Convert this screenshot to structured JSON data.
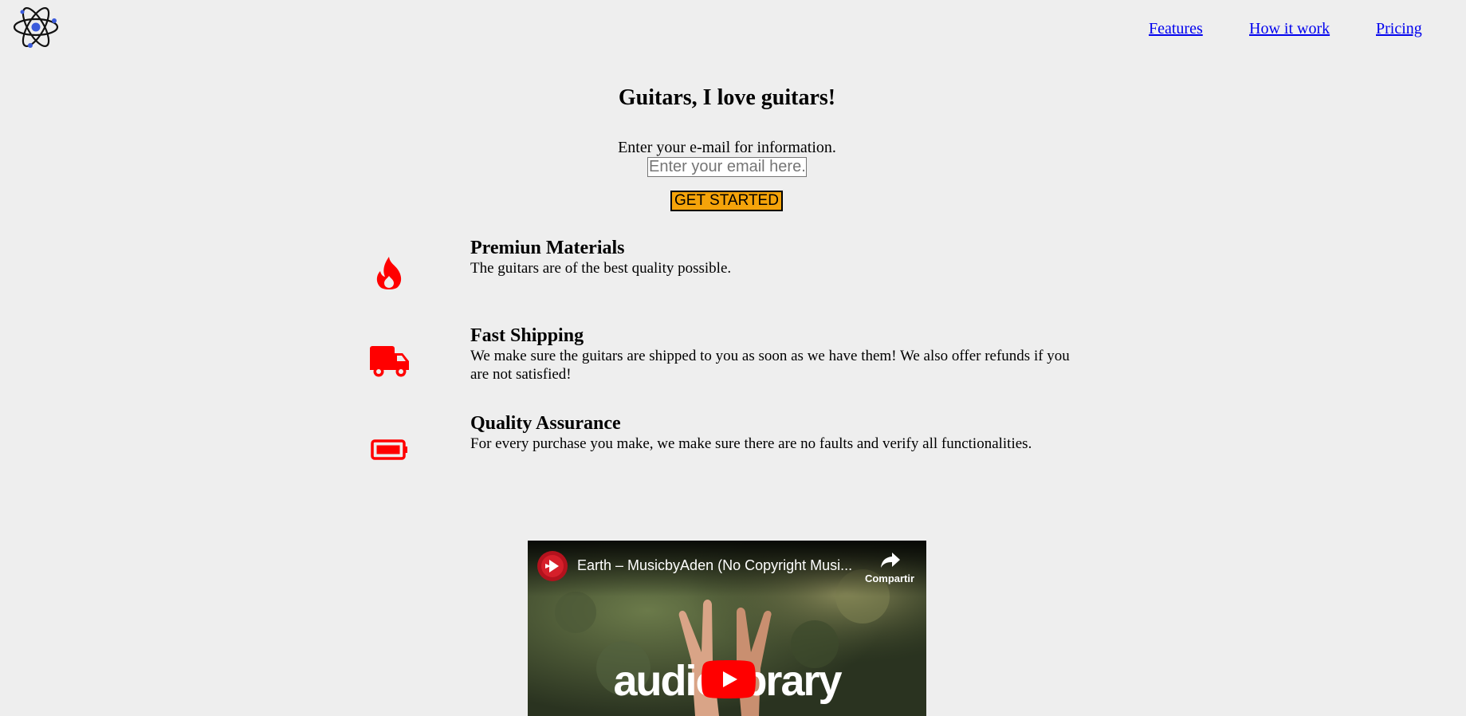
{
  "header": {
    "logo_icon": "atom-icon",
    "nav": [
      {
        "label": "Features"
      },
      {
        "label": "How it work"
      },
      {
        "label": "Pricing"
      }
    ]
  },
  "hero": {
    "title": "Guitars, I love guitars!",
    "email_label": "Enter your e-mail for information.",
    "email_placeholder": "Enter your email here.",
    "email_value": "",
    "cta_label": "GET STARTED"
  },
  "features": [
    {
      "icon": "fire-icon",
      "title": "Premiun Materials",
      "description": "The guitars are of the best quality possible."
    },
    {
      "icon": "truck-icon",
      "title": "Fast Shipping",
      "description": "We make sure the guitars are shipped to you as soon as we have them! We also offer refunds if you are not satisfied!"
    },
    {
      "icon": "battery-icon",
      "title": "Quality Assurance",
      "description": "For every purchase you make, we make sure there are no faults and verify all functionalities."
    }
  ],
  "video": {
    "title": "Earth – MusicbyAden (No Copyright Musi...",
    "share_label": "Compartir",
    "watermark_text": "audiolibrary"
  },
  "colors": {
    "background": "#eeeeee",
    "link": "#0000ee",
    "cta": "#f4a30a",
    "icon_red": "#ff0000",
    "youtube_red": "#ff0000"
  }
}
